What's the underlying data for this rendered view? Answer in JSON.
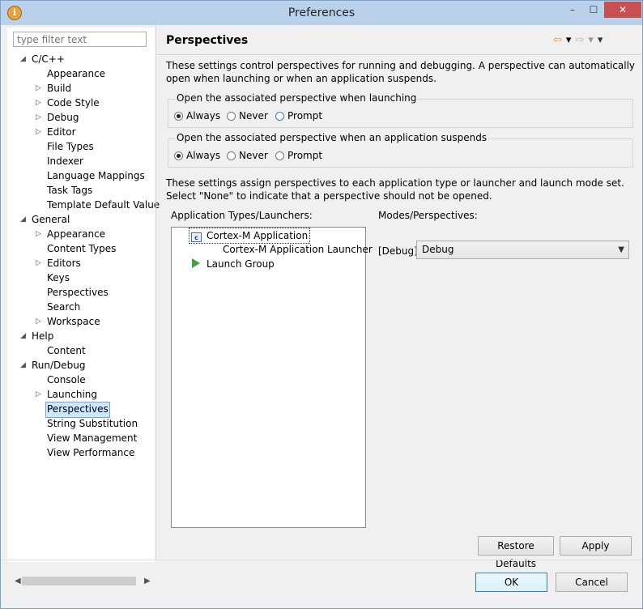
{
  "window": {
    "title": "Preferences",
    "minimize": "–",
    "maximize": "☐",
    "close": "✕"
  },
  "sidebar": {
    "filter_placeholder": "type filter text",
    "tree": [
      {
        "label": "C/C++",
        "level": 0,
        "arrow": "open"
      },
      {
        "label": "Appearance",
        "level": 1,
        "arrow": "none"
      },
      {
        "label": "Build",
        "level": 1,
        "arrow": "closed"
      },
      {
        "label": "Code Style",
        "level": 1,
        "arrow": "closed"
      },
      {
        "label": "Debug",
        "level": 1,
        "arrow": "closed"
      },
      {
        "label": "Editor",
        "level": 1,
        "arrow": "closed"
      },
      {
        "label": "File Types",
        "level": 1,
        "arrow": "none"
      },
      {
        "label": "Indexer",
        "level": 1,
        "arrow": "none"
      },
      {
        "label": "Language Mappings",
        "level": 1,
        "arrow": "none"
      },
      {
        "label": "Task Tags",
        "level": 1,
        "arrow": "none"
      },
      {
        "label": "Template Default Value",
        "level": 1,
        "arrow": "none"
      },
      {
        "label": "General",
        "level": 0,
        "arrow": "open"
      },
      {
        "label": "Appearance",
        "level": 1,
        "arrow": "closed"
      },
      {
        "label": "Content Types",
        "level": 1,
        "arrow": "none"
      },
      {
        "label": "Editors",
        "level": 1,
        "arrow": "closed"
      },
      {
        "label": "Keys",
        "level": 1,
        "arrow": "none"
      },
      {
        "label": "Perspectives",
        "level": 1,
        "arrow": "none"
      },
      {
        "label": "Search",
        "level": 1,
        "arrow": "none"
      },
      {
        "label": "Workspace",
        "level": 1,
        "arrow": "closed"
      },
      {
        "label": "Help",
        "level": 0,
        "arrow": "open"
      },
      {
        "label": "Content",
        "level": 1,
        "arrow": "none"
      },
      {
        "label": "Run/Debug",
        "level": 0,
        "arrow": "open"
      },
      {
        "label": "Console",
        "level": 1,
        "arrow": "none"
      },
      {
        "label": "Launching",
        "level": 1,
        "arrow": "closed"
      },
      {
        "label": "Perspectives",
        "level": 1,
        "arrow": "none",
        "selected": true
      },
      {
        "label": "String Substitution",
        "level": 1,
        "arrow": "none"
      },
      {
        "label": "View Management",
        "level": 1,
        "arrow": "none"
      },
      {
        "label": "View Performance",
        "level": 1,
        "arrow": "none"
      }
    ]
  },
  "page": {
    "title": "Perspectives",
    "nav": {
      "back": "⇦",
      "back_menu": "▾",
      "forward": "⇨",
      "forward_menu": "▾",
      "view_menu": "▾"
    },
    "intro": "These settings control perspectives for running and debugging. A perspective can automatically open when launching or when an application suspends.",
    "group_launch": {
      "label": "Open the associated perspective when launching",
      "options": [
        "Always",
        "Never",
        "Prompt"
      ],
      "selected": "Always"
    },
    "group_suspend": {
      "label": "Open the associated perspective when an application suspends",
      "options": [
        "Always",
        "Never",
        "Prompt"
      ],
      "selected": "Always"
    },
    "assign_text": "These settings assign perspectives to each application type or launcher and launch mode set. Select \"None\" to indicate that a perspective should not be opened.",
    "types_label": "Application Types/Launchers:",
    "modes_label": "Modes/Perspectives:",
    "types": [
      {
        "label": "Cortex-M Application",
        "icon": "c-app-icon",
        "selected": true
      },
      {
        "label": "Cortex-M Application Launcher",
        "icon": "none"
      },
      {
        "label": "Launch Group",
        "icon": "play-icon"
      }
    ],
    "mode_label": "[Debug]:",
    "mode_value": "Debug",
    "restore_defaults": "Restore Defaults",
    "apply": "Apply"
  },
  "footer": {
    "ok": "OK",
    "cancel": "Cancel"
  },
  "colors": {
    "titlebar": "#b9d1ea",
    "close": "#c75050",
    "selection": "#cce8ff"
  }
}
